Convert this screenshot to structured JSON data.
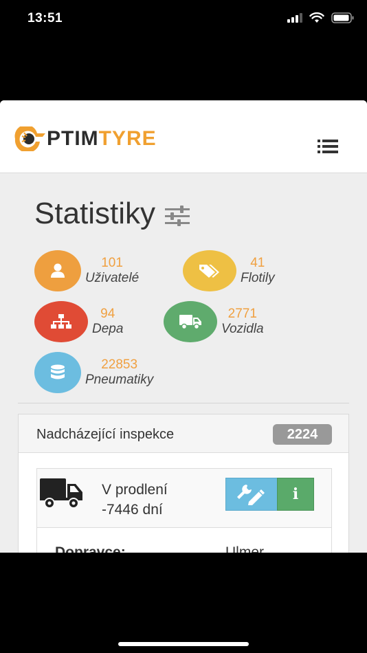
{
  "status_bar": {
    "time": "13:51"
  },
  "header": {
    "logo_left": "PTIM",
    "logo_right": "TYRE"
  },
  "page": {
    "title": "Statistiky"
  },
  "stats": [
    {
      "value": "101",
      "label": "Uživatelé",
      "color": "#ee9f3f",
      "icon": "user-icon"
    },
    {
      "value": "41",
      "label": "Flotily",
      "color": "#eec044",
      "icon": "tags-icon"
    },
    {
      "value": "94",
      "label": "Depa",
      "color": "#e04b35",
      "icon": "sitemap-icon"
    },
    {
      "value": "2771",
      "label": "Vozidla",
      "color": "#5fab6d",
      "icon": "truck-icon"
    },
    {
      "value": "22853",
      "label": "Pneumatiky",
      "color": "#6cbde0",
      "icon": "database-icon"
    }
  ],
  "inspections": {
    "title": "Nadcházející inspekce",
    "count": "2224",
    "card": {
      "status_line1": "V prodlení",
      "status_line2": "-7446 dní",
      "info_label": "i",
      "carrier_label": "Dopravce:",
      "carrier_value": "Ulmer"
    }
  }
}
